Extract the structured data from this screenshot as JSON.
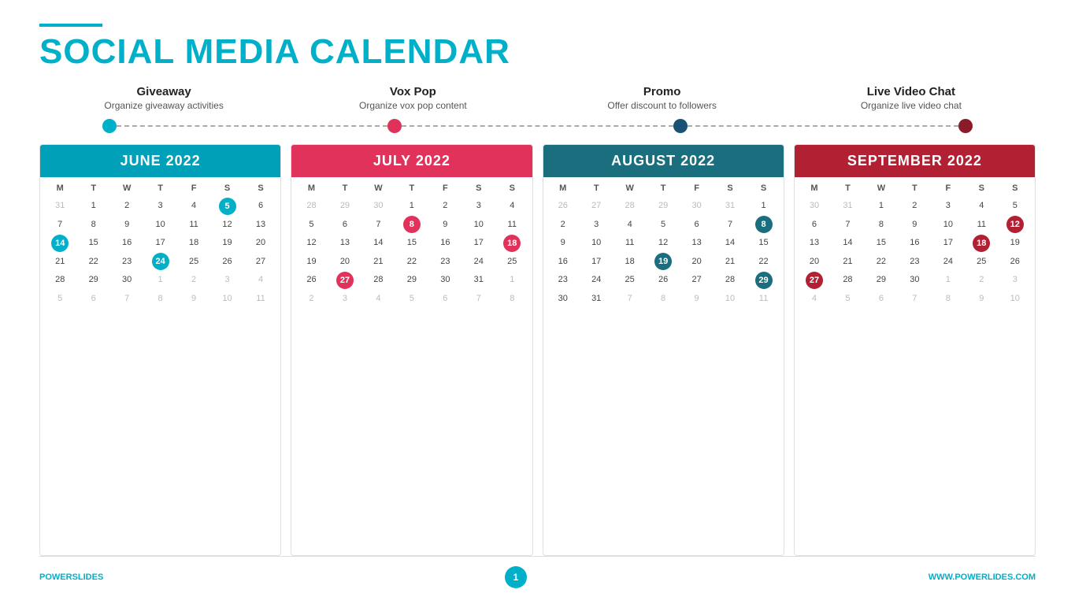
{
  "header": {
    "line_color": "#00b0c8",
    "title_black": "SOCIAL MEDIA",
    "title_colored": "CALENDAR"
  },
  "categories": [
    {
      "id": "giveaway",
      "title": "Giveaway",
      "subtitle": "Organize giveaway activities"
    },
    {
      "id": "vox-pop",
      "title": "Vox Pop",
      "subtitle": "Organize vox pop content"
    },
    {
      "id": "promo",
      "title": "Promo",
      "subtitle": "Offer discount to followers"
    },
    {
      "id": "live-video",
      "title": "Live Video Chat",
      "subtitle": "Organize live video chat"
    }
  ],
  "calendars": [
    {
      "id": "june-2022",
      "month": "JUNE 2022",
      "color_class": "teal",
      "days": [
        "M",
        "T",
        "W",
        "T",
        "F",
        "S",
        "S"
      ],
      "weeks": [
        [
          "31",
          "1",
          "2",
          "3",
          "4",
          "5",
          "6"
        ],
        [
          "7",
          "8",
          "9",
          "10",
          "11",
          "12",
          "13"
        ],
        [
          "14",
          "15",
          "16",
          "17",
          "18",
          "19",
          "20"
        ],
        [
          "21",
          "22",
          "23",
          "24",
          "25",
          "26",
          "27"
        ],
        [
          "28",
          "29",
          "30",
          "1",
          "2",
          "3",
          "4"
        ],
        [
          "5",
          "6",
          "7",
          "8",
          "9",
          "10",
          "11"
        ]
      ],
      "faded_cells": {
        "0-0": true,
        "4-3": true,
        "4-4": true,
        "4-5": true,
        "4-6": true,
        "5-0": true,
        "5-1": true,
        "5-2": true,
        "5-3": true,
        "5-4": true,
        "5-5": true,
        "5-6": true
      },
      "highlights": {
        "0-5": "hl-teal",
        "2-0": "hl-teal",
        "3-3": "hl-teal"
      }
    },
    {
      "id": "july-2022",
      "month": "JULY 2022",
      "color_class": "pink",
      "days": [
        "M",
        "T",
        "W",
        "T",
        "F",
        "S",
        "S"
      ],
      "weeks": [
        [
          "28",
          "29",
          "30",
          "1",
          "2",
          "3",
          "4"
        ],
        [
          "5",
          "6",
          "7",
          "8",
          "9",
          "10",
          "11"
        ],
        [
          "12",
          "13",
          "14",
          "15",
          "16",
          "17",
          "18"
        ],
        [
          "19",
          "20",
          "21",
          "22",
          "23",
          "24",
          "25"
        ],
        [
          "26",
          "27",
          "28",
          "29",
          "30",
          "31",
          "1"
        ],
        [
          "2",
          "3",
          "4",
          "5",
          "6",
          "7",
          "8"
        ]
      ],
      "faded_cells": {
        "0-0": true,
        "0-1": true,
        "0-2": true,
        "4-6": true,
        "5-0": true,
        "5-1": true,
        "5-2": true,
        "5-3": true,
        "5-4": true,
        "5-5": true,
        "5-6": true
      },
      "highlights": {
        "1-3": "hl-pink",
        "2-6": "hl-pink",
        "3-1": "hl-pink"
      }
    },
    {
      "id": "august-2022",
      "month": "AUGUST 2022",
      "color_class": "dark-teal",
      "days": [
        "M",
        "T",
        "W",
        "T",
        "F",
        "S",
        "S"
      ],
      "weeks": [
        [
          "26",
          "27",
          "28",
          "29",
          "30",
          "31",
          "1"
        ],
        [
          "2",
          "3",
          "4",
          "5",
          "6",
          "7",
          "8"
        ],
        [
          "9",
          "10",
          "11",
          "12",
          "13",
          "14",
          "15"
        ],
        [
          "16",
          "17",
          "18",
          "19",
          "20",
          "21",
          "22"
        ],
        [
          "23",
          "24",
          "25",
          "26",
          "27",
          "28",
          "29"
        ],
        [
          "30",
          "31",
          "7",
          "8",
          "9",
          "10",
          "11"
        ]
      ],
      "faded_cells": {
        "0-0": true,
        "0-1": true,
        "0-2": true,
        "0-3": true,
        "0-4": true,
        "0-5": true,
        "5-2": true,
        "5-3": true,
        "5-4": true,
        "5-5": true,
        "5-6": true
      },
      "highlights": {
        "1-6": "hl-dteal",
        "3-3": "hl-dteal",
        "4-6": "hl-dteal"
      }
    },
    {
      "id": "september-2022",
      "month": "SEPTEMBER 2022",
      "color_class": "dark-red",
      "days": [
        "M",
        "T",
        "W",
        "T",
        "F",
        "S",
        "S"
      ],
      "weeks": [
        [
          "30",
          "31",
          "1",
          "2",
          "3",
          "4",
          "5"
        ],
        [
          "6",
          "7",
          "8",
          "9",
          "10",
          "11",
          "12"
        ],
        [
          "13",
          "14",
          "15",
          "16",
          "17",
          "18",
          "19"
        ],
        [
          "20",
          "21",
          "22",
          "23",
          "24",
          "25",
          "26"
        ],
        [
          "27",
          "28",
          "29",
          "30",
          "1",
          "2",
          "3"
        ],
        [
          "4",
          "5",
          "6",
          "7",
          "8",
          "9",
          "10"
        ]
      ],
      "faded_cells": {
        "0-0": true,
        "0-1": true,
        "4-4": true,
        "4-5": true,
        "4-6": true,
        "5-0": true,
        "5-1": true,
        "5-2": true,
        "5-3": true,
        "5-4": true,
        "5-5": true,
        "5-6": true
      },
      "highlights": {
        "1-6": "hl-dred",
        "2-5": "hl-dred",
        "3-0": "hl-dred"
      }
    }
  ],
  "footer": {
    "left_black": "POWER",
    "left_colored": "SLIDES",
    "page_number": "1",
    "right_text": "WWW.POWERLIDES.COM"
  }
}
